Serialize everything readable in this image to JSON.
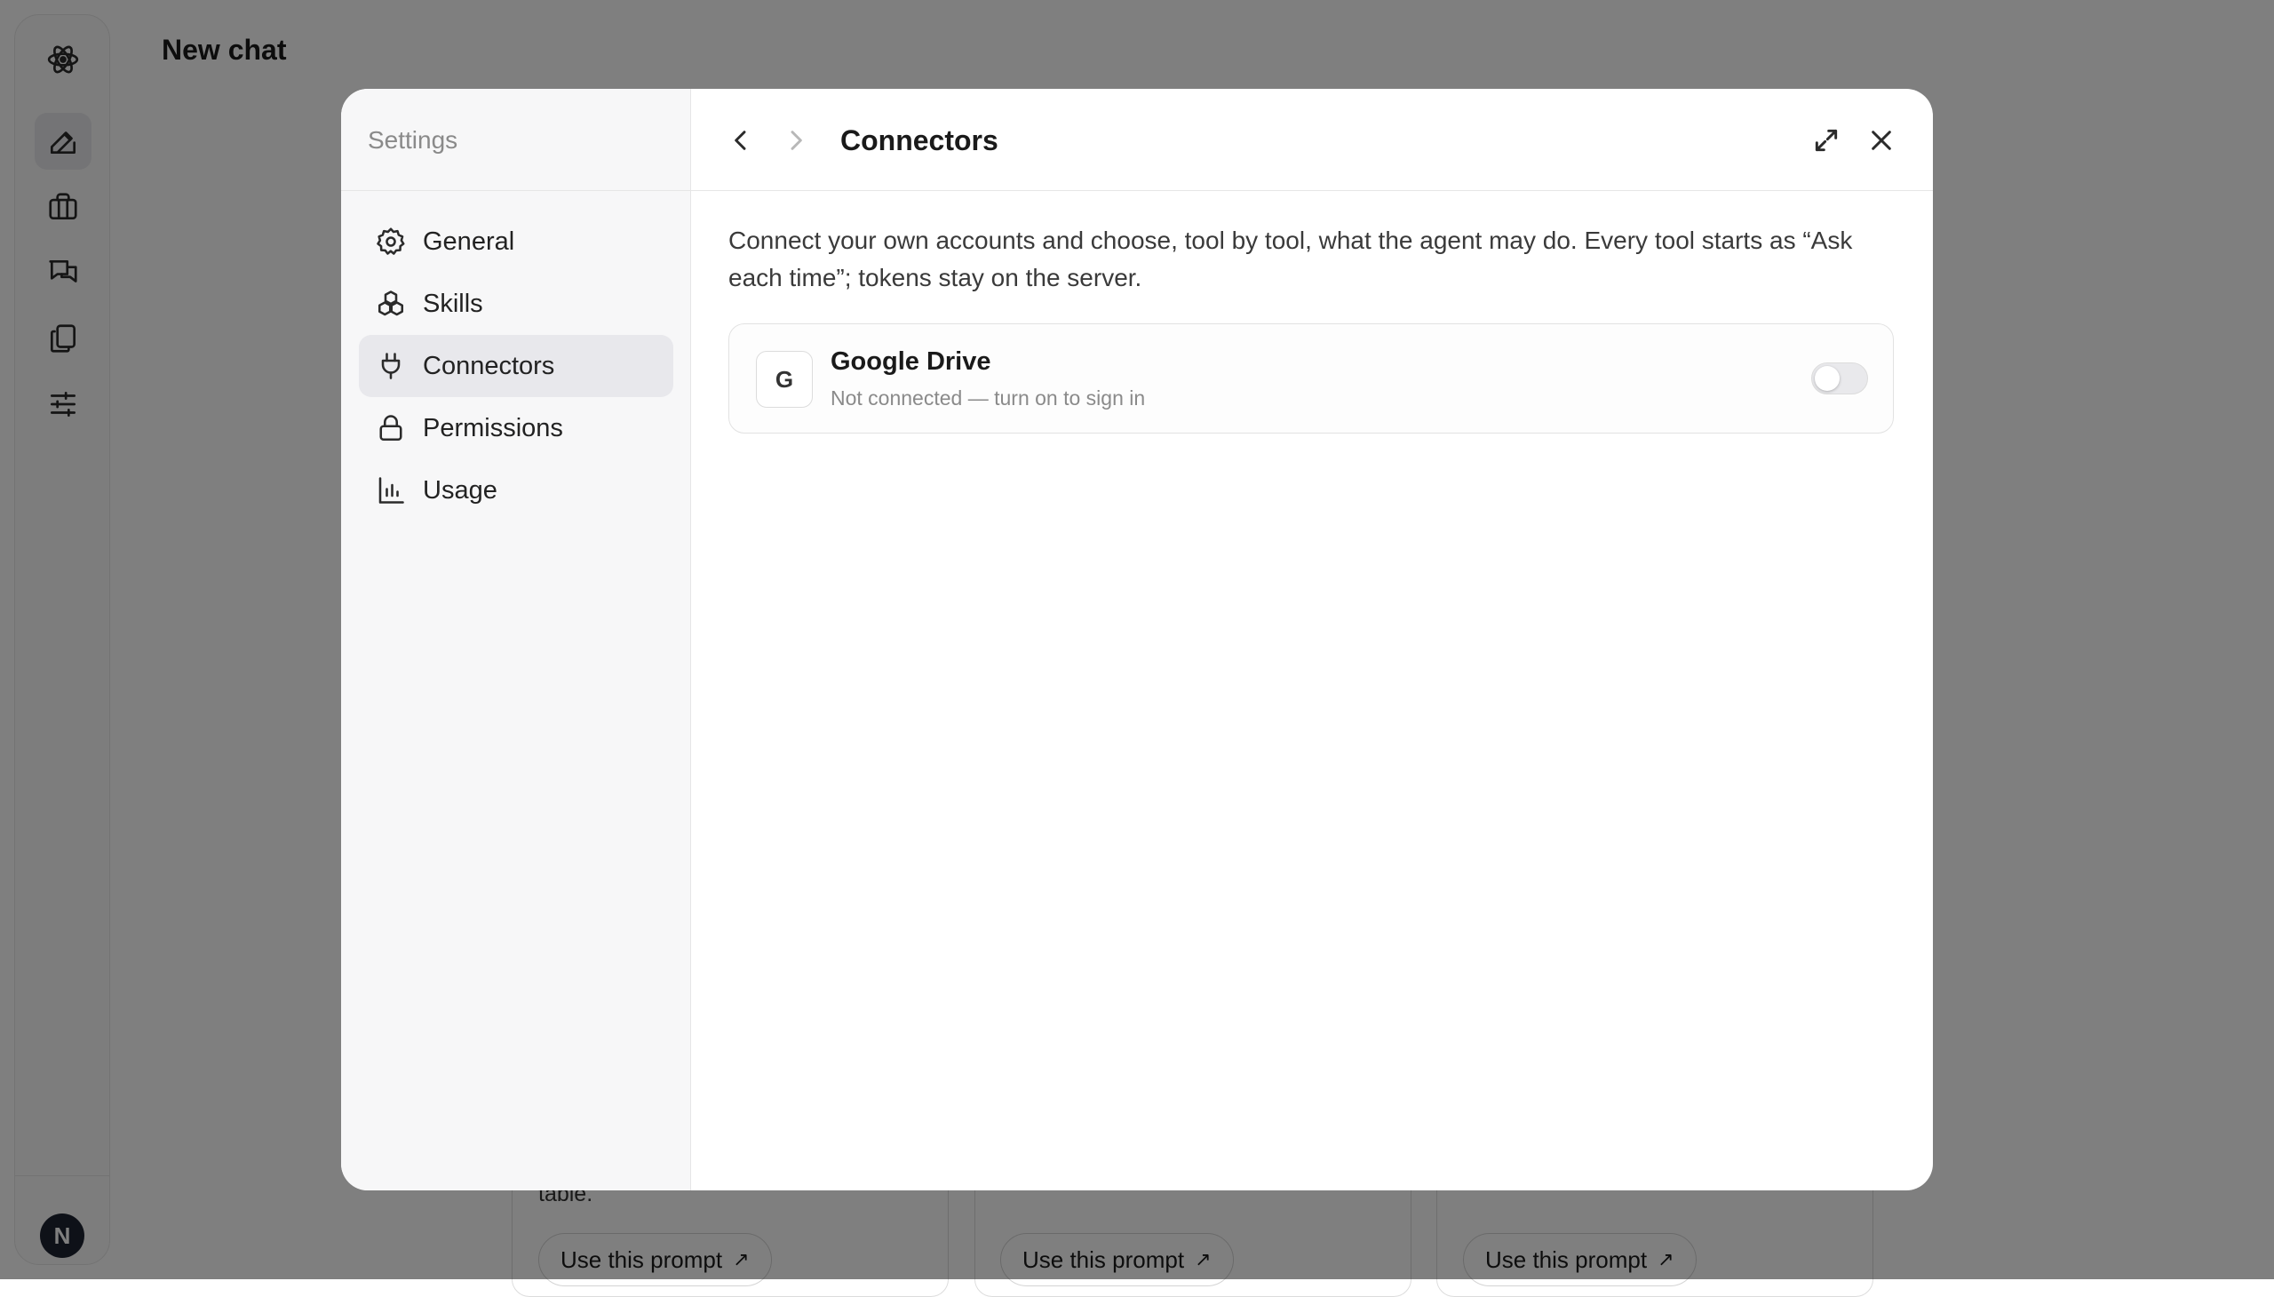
{
  "app": {
    "page_title": "New chat",
    "avatar_initial": "N",
    "rail_icons": [
      "atom-logo-icon",
      "edit-icon",
      "briefcase-icon",
      "chat-icon",
      "documents-icon",
      "sliders-icon"
    ]
  },
  "background_cards": {
    "partial_text": "table.",
    "prompt_button_label": "Use this prompt",
    "arrow_glyph": "↗"
  },
  "settings": {
    "title": "Settings",
    "active_section": "Connectors",
    "nav": [
      {
        "label": "General",
        "icon": "gear-icon"
      },
      {
        "label": "Skills",
        "icon": "skills-icon"
      },
      {
        "label": "Connectors",
        "icon": "plug-icon"
      },
      {
        "label": "Permissions",
        "icon": "lock-icon"
      },
      {
        "label": "Usage",
        "icon": "chart-icon"
      }
    ]
  },
  "main": {
    "title": "Connectors",
    "description": "Connect your own accounts and choose, tool by tool, what the agent may do. Every tool starts as “Ask each time”; tokens stay on the server.",
    "connectors": [
      {
        "logo": "G",
        "name": "Google Drive",
        "status": "Not connected — turn on to sign in",
        "enabled": false
      }
    ]
  },
  "colors": {
    "overlay": "#000000",
    "nav_active": "#e8e8ec",
    "toggle_off": "#e9e9ec"
  }
}
